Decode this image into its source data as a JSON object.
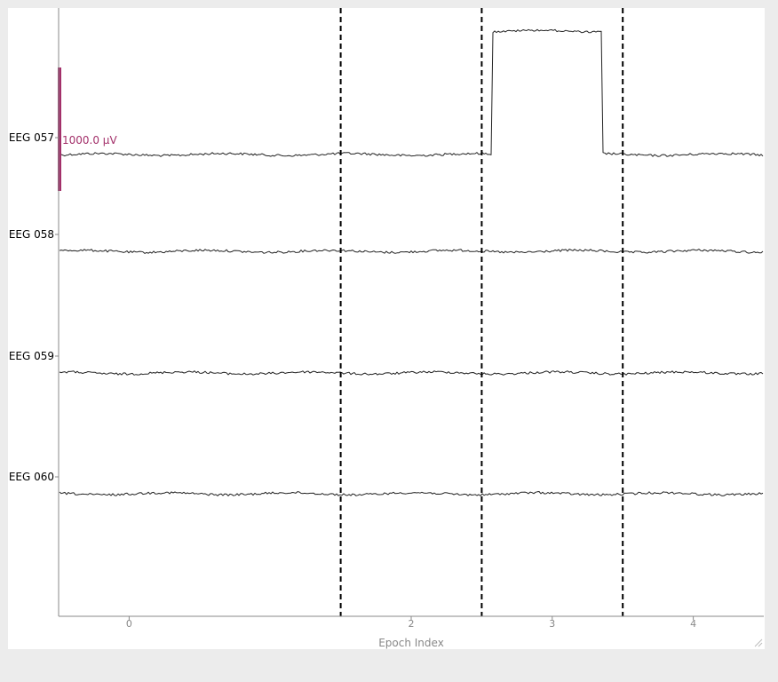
{
  "chart_data": {
    "type": "line",
    "title": "",
    "xlabel": "Epoch Index",
    "ylabel": "",
    "xlim": [
      -0.5,
      4.5
    ],
    "x_ticks": [
      {
        "pos": 0,
        "label": "0"
      },
      {
        "pos": 2,
        "label": "2"
      },
      {
        "pos": 3,
        "label": "3"
      },
      {
        "pos": 4,
        "label": "4"
      }
    ],
    "epoch_boundaries": [
      1.5,
      2.5,
      3.5
    ],
    "channels": [
      "EEG 057",
      "EEG 058",
      "EEG 059",
      "EEG 060"
    ],
    "scale_bar": {
      "label": "1000.0 µV",
      "value": 1000.0,
      "unit": "µV",
      "channel": "EEG 057"
    },
    "artifact": {
      "channel": "EEG 057",
      "x_start": 2.57,
      "x_end": 3.36,
      "amplitude_uV": 1000
    },
    "grid": false,
    "legend": "none"
  },
  "colors": {
    "trace": "#222222",
    "scale_bar": "#a3306a",
    "axis": "#888888",
    "tick_label": "#888888",
    "epoch_line": "#000000"
  }
}
